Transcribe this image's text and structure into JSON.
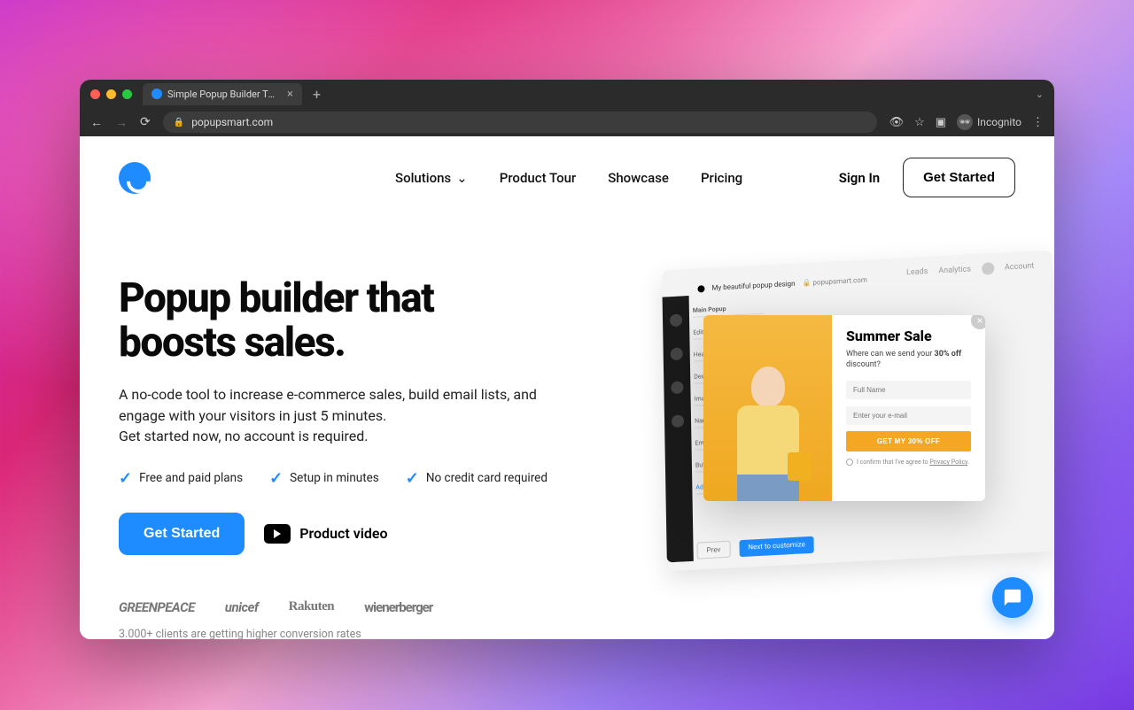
{
  "browser": {
    "tab_title": "Simple Popup Builder That Bo…",
    "url": "popupsmart.com",
    "incognito_label": "Incognito"
  },
  "nav": {
    "solutions": "Solutions",
    "product_tour": "Product Tour",
    "showcase": "Showcase",
    "pricing": "Pricing",
    "sign_in": "Sign In",
    "get_started": "Get Started"
  },
  "hero": {
    "title_line1": "Popup builder that",
    "title_line2": "boosts sales.",
    "sub_line1": "A no-code tool to increase e-commerce sales, build email lists, and engage with your visitors in just 5 minutes.",
    "sub_line2": "Get started now, no account is required.",
    "feature1": "Free and paid plans",
    "feature2": "Setup in minutes",
    "feature3": "No credit card required",
    "cta": "Get Started",
    "video": "Product video"
  },
  "clients": {
    "logo1": "GREENPEACE",
    "logo2": "unicef",
    "logo3": "Rakuten",
    "logo4": "wienerberger",
    "stats": "3.000+ clients are getting higher conversion rates"
  },
  "mock": {
    "header_title": "My beautiful popup design",
    "header_url": "popupsmart.com",
    "top_leads": "Leads",
    "top_analytics": "Analytics",
    "top_account": "Account",
    "panel": {
      "main": "Main Popup",
      "edit": "Edit Des...",
      "headline": "Headline",
      "description": "Description",
      "image": "Image",
      "name_input": "Name Input",
      "email_input": "Email Input",
      "button": "Button",
      "add": "Add a new f..."
    },
    "popup": {
      "title": "Summer Sale",
      "sub_pre": "Where can we send your ",
      "sub_bold": "30% off",
      "sub_post": " discount?",
      "name_placeholder": "Full Name",
      "email_placeholder": "Enter your e-mail",
      "cta": "GET MY 30% OFF",
      "confirm": "I confirm that I've agree to",
      "policy": "Privacy Policy"
    },
    "bottom": {
      "prev": "Prev",
      "next": "Next to customize"
    }
  }
}
